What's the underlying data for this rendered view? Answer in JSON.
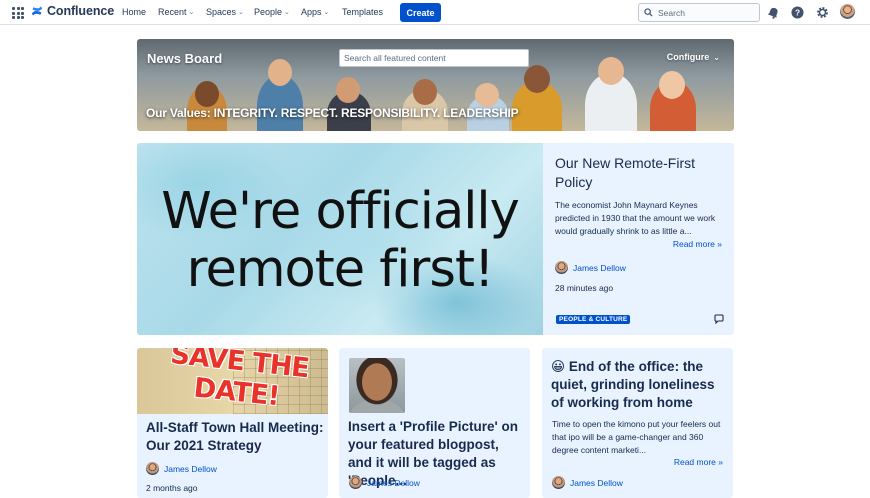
{
  "app": {
    "name": "Confluence"
  },
  "nav": {
    "home": "Home",
    "recent": "Recent",
    "spaces": "Spaces",
    "people": "People",
    "apps": "Apps",
    "templates": "Templates",
    "create": "Create",
    "search_placeholder": "Search"
  },
  "icons": {
    "app_switcher": "grid-icon",
    "notifications": "bell-icon",
    "help": "help-icon",
    "settings": "gear-icon"
  },
  "banner": {
    "title": "News Board",
    "search_placeholder": "Search all featured content",
    "configure": "Configure",
    "values": "Our Values: INTEGRITY. RESPECT. RESPONSIBILITY. LEADERSHIP"
  },
  "featured": {
    "image_text_line1": "We're officially",
    "image_text_line2": "remote first!",
    "title": "Our New Remote-First Policy",
    "excerpt": "The economist John Maynard Keynes predicted in 1930 that the amount we work would gradually shrink to as little a...",
    "read_more": "Read more",
    "author": "James Dellow",
    "time": "28 minutes ago",
    "tag": "PEOPLE & CULTURE"
  },
  "cards": [
    {
      "image_text": "SAVE THE DATE!",
      "title": "All-Staff Town Hall Meeting: Our 2021 Strategy",
      "author": "James Dellow",
      "time": "2 months ago"
    },
    {
      "title": "Insert a 'Profile Picture' on your featured blogpost, and it will be tagged as 'People...",
      "author": "James Dellow"
    },
    {
      "title": "😀 End of the office: the quiet, grinding loneliness of working from home",
      "excerpt": "Time to open the kimono put your feelers out that ipo will be a game-changer and 360 degree content marketi...",
      "read_more": "Read more",
      "author": "James Dellow"
    }
  ],
  "colors": {
    "brand": "#0052cc",
    "card_bg": "#e9f2ff",
    "text": "#172b4d"
  }
}
